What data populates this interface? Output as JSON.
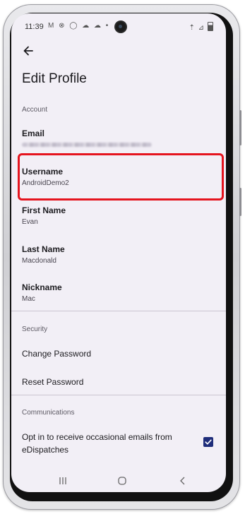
{
  "status_bar": {
    "time": "11:39",
    "left_icons": "M ⊗ ◯ ☁ ☁ •",
    "right_icons": "⇡ ▰"
  },
  "app_bar": {
    "back_icon": "arrow-back-icon",
    "title": "Edit Profile"
  },
  "account": {
    "header": "Account",
    "items": [
      {
        "label": "Email",
        "value": ""
      },
      {
        "label": "Username",
        "value": "AndroidDemo2"
      },
      {
        "label": "First Name",
        "value": "Evan"
      },
      {
        "label": "Last Name",
        "value": "Macdonald"
      },
      {
        "label": "Nickname",
        "value": "Mac"
      }
    ]
  },
  "security": {
    "header": "Security",
    "items": [
      "Change Password",
      "Reset Password"
    ]
  },
  "communications": {
    "header": "Communications",
    "optin_label": "Opt in to receive occasional emails from eDispatches",
    "optin_checked": true
  },
  "colors": {
    "screen_bg": "#f2eff6",
    "highlight": "#e5141e",
    "checkbox": "#1f2d7a"
  }
}
